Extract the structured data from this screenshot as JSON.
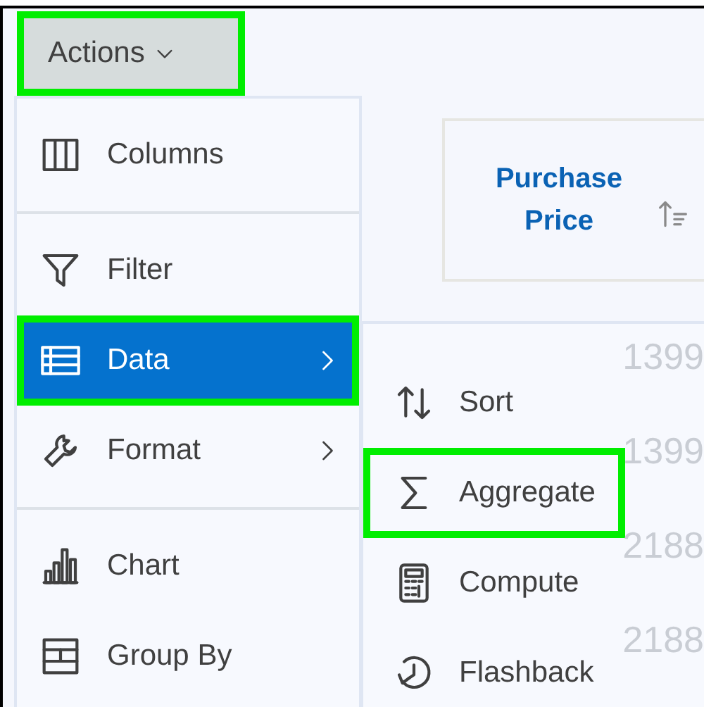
{
  "actions_button": {
    "label": "Actions",
    "highlighted": true
  },
  "table": {
    "columns": [
      {
        "label": "Purchase Price",
        "sort_ascending": true
      }
    ],
    "rows": [
      [
        "1399"
      ],
      [
        "1399"
      ],
      [
        "2188"
      ],
      [
        "2188"
      ]
    ]
  },
  "menu": {
    "groups": [
      [
        {
          "label": "Columns",
          "selected": false,
          "submenu": false,
          "highlighted": false
        }
      ],
      [
        {
          "label": "Filter",
          "selected": false,
          "submenu": false,
          "highlighted": false
        },
        {
          "label": "Data",
          "selected": true,
          "submenu": true,
          "highlighted": true
        },
        {
          "label": "Format",
          "selected": false,
          "submenu": true,
          "highlighted": false
        }
      ],
      [
        {
          "label": "Chart",
          "selected": false,
          "submenu": false,
          "highlighted": false
        },
        {
          "label": "Group By",
          "selected": false,
          "submenu": false,
          "highlighted": false
        }
      ]
    ]
  },
  "submenu": {
    "items": [
      {
        "label": "Sort",
        "highlighted": false
      },
      {
        "label": "Aggregate",
        "highlighted": true
      },
      {
        "label": "Compute",
        "highlighted": false
      },
      {
        "label": "Flashback",
        "highlighted": false
      }
    ]
  }
}
